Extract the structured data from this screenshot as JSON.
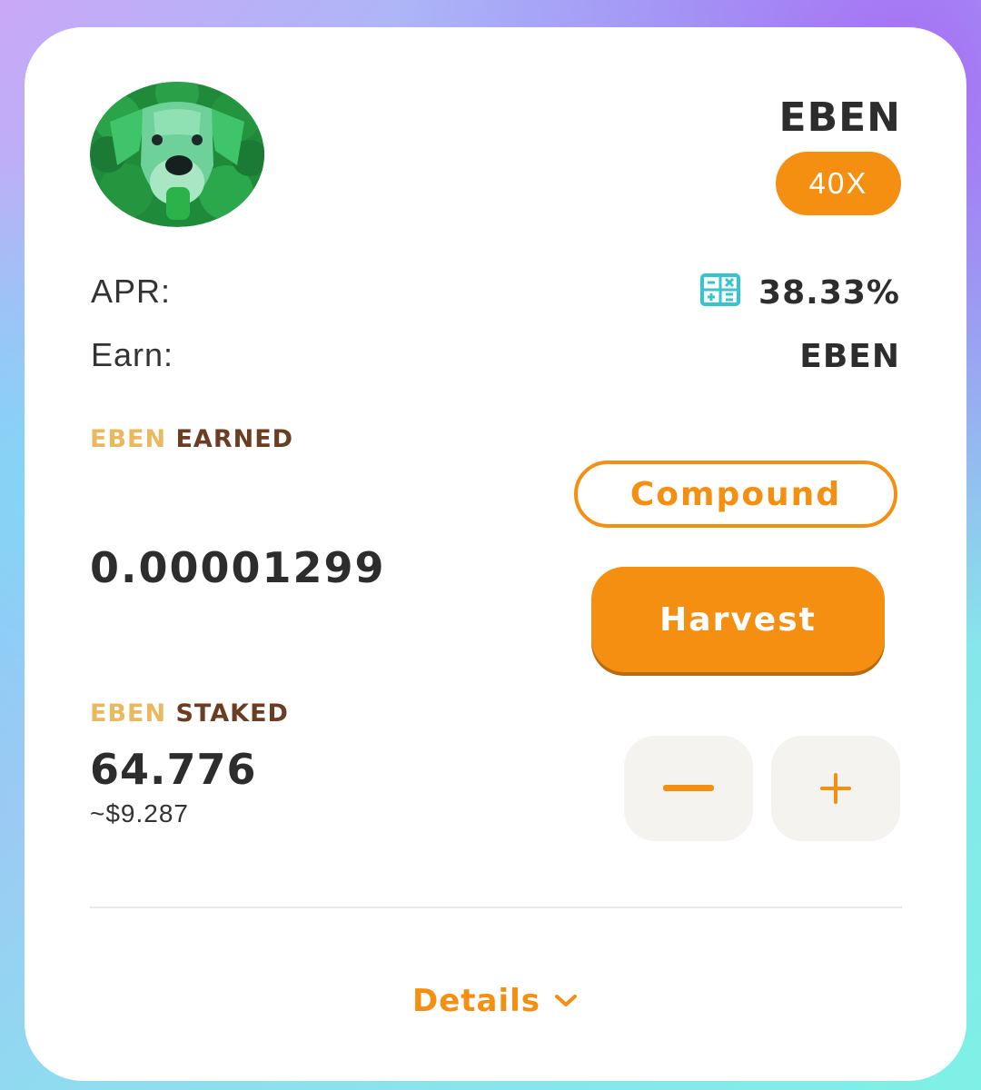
{
  "pool": {
    "token_name": "EBEN",
    "multiplier": "40X",
    "logo_icon": "green-dog-avatar-icon"
  },
  "stats": {
    "apr_label": "APR:",
    "apr_value": "38.33%",
    "calculator_icon": "calculator-icon",
    "earn_label": "Earn:",
    "earn_value": "EBEN"
  },
  "earned": {
    "title_token": "EBEN",
    "title_word": "EARNED",
    "amount": "0.00001299",
    "compound_label": "Compound",
    "harvest_label": "Harvest"
  },
  "staked": {
    "title_token": "EBEN",
    "title_word": "STAKED",
    "amount": "64.776",
    "usd_value": "~$9.287",
    "minus_icon": "minus-icon",
    "plus_icon": "plus-icon"
  },
  "footer": {
    "details_label": "Details",
    "chevron_icon": "chevron-down-icon"
  },
  "colors": {
    "accent": "#f58f11",
    "token_title": "#eab85e",
    "section_word": "#6b3d22",
    "calc_icon": "#31c6d2",
    "text_dark": "#2d2d2d"
  }
}
